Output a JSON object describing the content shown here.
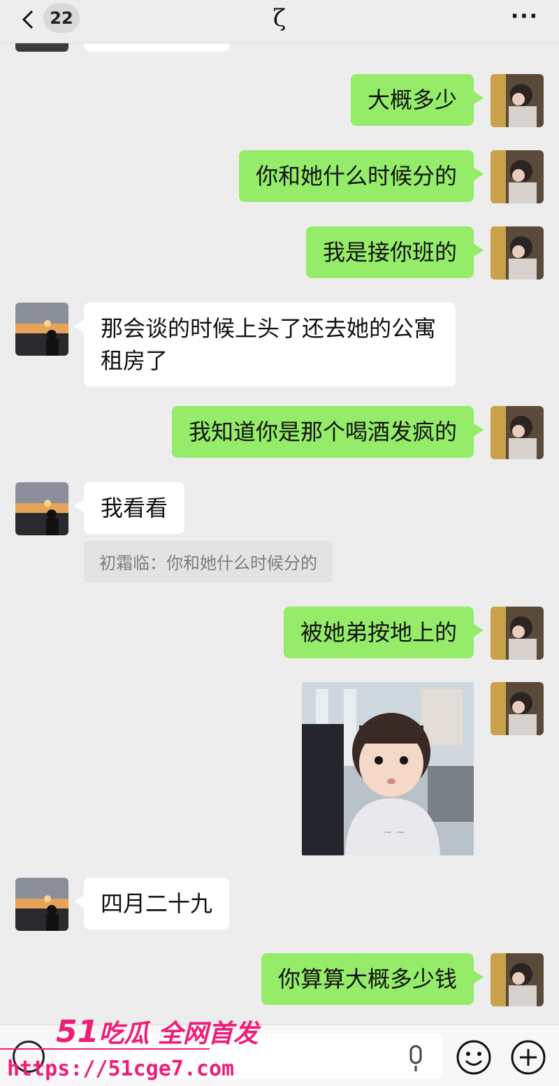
{
  "header": {
    "unread_count": "22",
    "title": "ζ",
    "more_label": "···"
  },
  "messages": [
    {
      "from": "me",
      "text": "大概多少"
    },
    {
      "from": "me",
      "text": "你和她什么时候分的"
    },
    {
      "from": "me",
      "text": "我是接你班的"
    },
    {
      "from": "other",
      "text": "那会谈的时候上头了还去她的公寓租房了"
    },
    {
      "from": "me",
      "text": "我知道你是那个喝酒发疯的"
    },
    {
      "from": "other",
      "text": "我看看",
      "quote": "初霜临：你和她什么时候分的"
    },
    {
      "from": "me",
      "text": "被她弟按地上的"
    },
    {
      "from": "me",
      "type": "image"
    },
    {
      "from": "other",
      "text": "四月二十九"
    },
    {
      "from": "me",
      "text": "你算算大概多少钱"
    }
  ],
  "watermark": {
    "brand_num": "51",
    "brand_text": "吃瓜 全网首发",
    "url": "https://51cge7.com"
  },
  "colors": {
    "my_bubble": "#95ec69",
    "other_bubble": "#ffffff",
    "background": "#ededed",
    "watermark": "#ee1d7a"
  }
}
